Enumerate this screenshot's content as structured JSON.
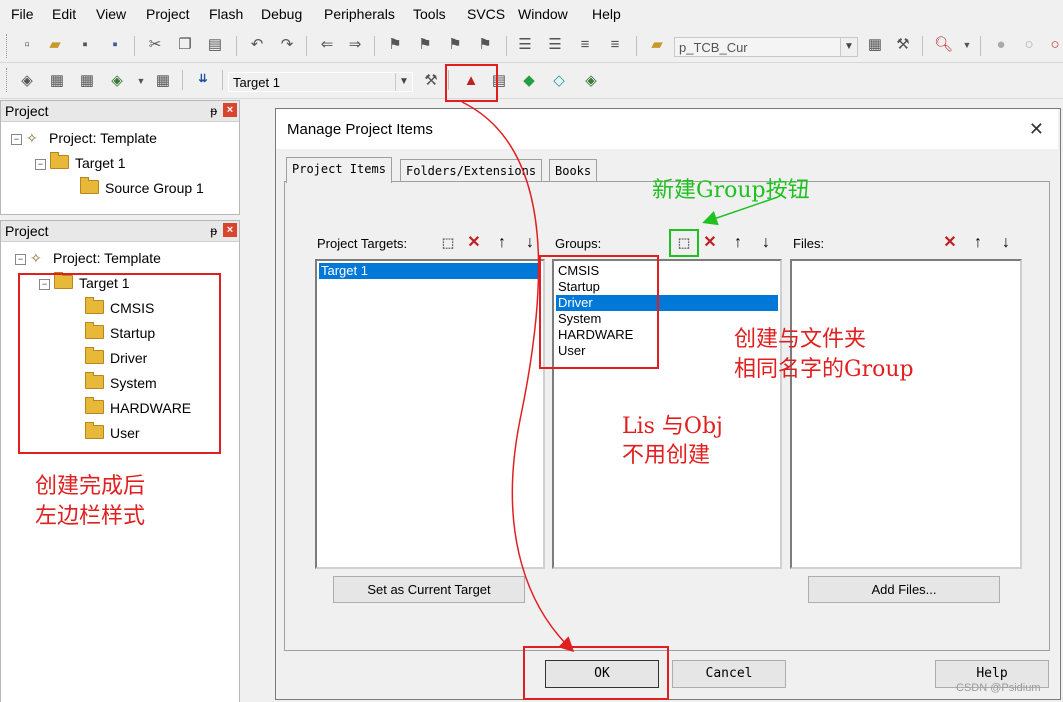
{
  "menu": [
    "File",
    "Edit",
    "View",
    "Project",
    "Flash",
    "Debug",
    "Peripherals",
    "Tools",
    "SVCS",
    "Window",
    "Help"
  ],
  "toolbar1": {
    "function_combo": "p_TCB_Cur"
  },
  "toolbar2": {
    "target_combo": "Target 1"
  },
  "panel_top": {
    "title": "Project",
    "pin": "ᵽ",
    "close": "×",
    "tree": {
      "project": "Project: Template",
      "target": "Target 1",
      "group": "Source Group 1"
    }
  },
  "panel_bottom": {
    "title": "Project",
    "pin": "ᵽ",
    "close": "×",
    "tree": {
      "project": "Project: Template",
      "target": "Target 1",
      "groups": [
        "CMSIS",
        "Startup",
        "Driver",
        "System",
        "HARDWARE",
        "User"
      ]
    }
  },
  "dialog": {
    "title": "Manage Project Items",
    "close": "✕",
    "tabs": [
      "Project Items",
      "Folders/Extensions",
      "Books"
    ],
    "targets": {
      "label": "Project Targets:",
      "items": [
        "Target 1"
      ],
      "selected": 0
    },
    "groups": {
      "label": "Groups:",
      "items": [
        "CMSIS",
        "Startup",
        "Driver",
        "System",
        "HARDWARE",
        "User"
      ],
      "selected": 2
    },
    "files": {
      "label": "Files:",
      "items": []
    },
    "set_target_button": "Set as Current Target",
    "add_files_button": "Add Files...",
    "ok_button": "OK",
    "cancel_button": "Cancel",
    "help_button": "Help"
  },
  "annotations": {
    "new_group": "新建Group按钮",
    "same_name_line1": "创建与文件夹",
    "same_name_line2": "相同名字的Group",
    "lis_obj_line1": "Lis 与Obj",
    "lis_obj_line2": "不用创建",
    "sidebar_line1": "创建完成后",
    "sidebar_line2": "左边栏样式"
  },
  "watermark": "CSDN @Psidium",
  "colors": {
    "annotation_red": "#e02020",
    "annotation_green": "#20c020",
    "selection": "#0078d7"
  }
}
